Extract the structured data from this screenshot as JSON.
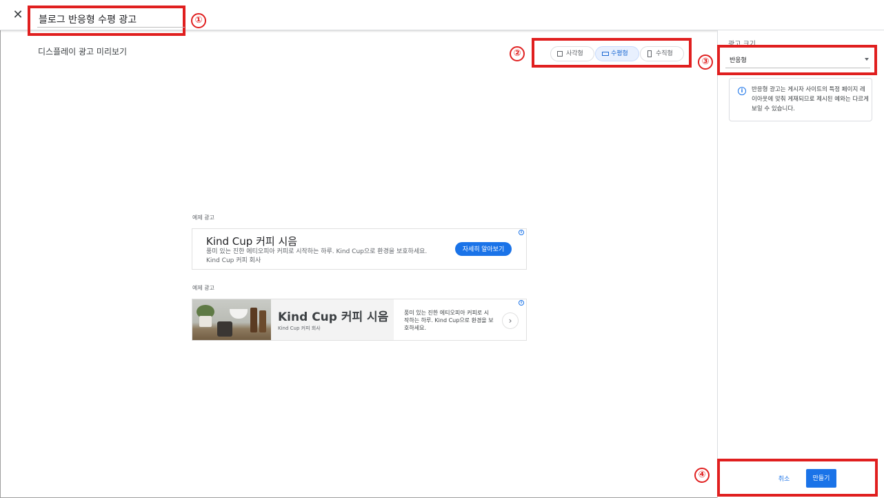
{
  "header": {
    "title_value": "블로그 반응형 수평 광고"
  },
  "markers": [
    "①",
    "②",
    "③",
    "④"
  ],
  "preview": {
    "label": "디스플레이 광고 미리보기",
    "shapes": [
      {
        "label": "사각형",
        "active": false
      },
      {
        "label": "수평형",
        "active": true
      },
      {
        "label": "수직형",
        "active": false
      }
    ],
    "example_label": "예제 광고",
    "ad1": {
      "title": "Kind Cup 커피 시음",
      "description": "풍미 있는 진한 에티오피아 커피로 시작하는 하루. Kind Cup으로 환경을 보호하세요. Kind Cup 커피 회사",
      "cta": "자세히 알아보기"
    },
    "ad2": {
      "title": "Kind Cup 커피 시음",
      "company": "Kind Cup 커피 회사",
      "description": "풍미 있는 진한 에티오피아 커피로 시작하는 하루. Kind Cup으로 환경을 보호하세요.",
      "arrow": "›"
    }
  },
  "side": {
    "size_label": "광고 크기",
    "size_value": "반응형",
    "info": "반응형 광고는 게시자 사이트의 특정 페이지 레이아웃에 맞춰 게재되므로 제시된 예와는 다르게 보일 수 있습니다."
  },
  "footer": {
    "cancel": "취소",
    "create": "만들기"
  },
  "colors": {
    "accent": "#1a73e8",
    "highlight_box": "#e01f1f"
  }
}
